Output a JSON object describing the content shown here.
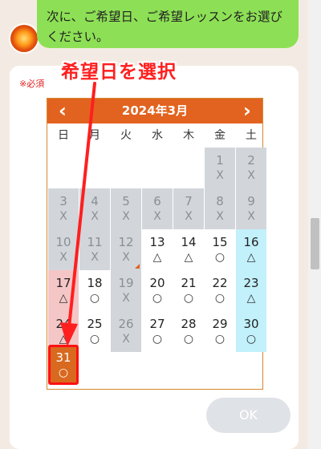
{
  "chat": {
    "message": "次に、ご希望日、ご希望レッスンをお選びください。"
  },
  "form": {
    "required_label": "※必須",
    "ok_button": "OK"
  },
  "annotation": {
    "text": "希望日を選択",
    "color": "#ff1f1f"
  },
  "calendar": {
    "title": "2024年3月",
    "prev_icon": "chevron-left-icon",
    "next_icon": "chevron-right-icon",
    "weekdays": [
      "日",
      "月",
      "火",
      "水",
      "木",
      "金",
      "土"
    ],
    "header_color": "#e2631f",
    "selected_day": "31",
    "weeks": [
      [
        null,
        null,
        null,
        null,
        null,
        {
          "day": "1",
          "mark": "X",
          "status": "past"
        },
        {
          "day": "2",
          "mark": "X",
          "status": "past"
        }
      ],
      [
        {
          "day": "3",
          "mark": "X",
          "status": "past"
        },
        {
          "day": "4",
          "mark": "X",
          "status": "past"
        },
        {
          "day": "5",
          "mark": "X",
          "status": "past"
        },
        {
          "day": "6",
          "mark": "X",
          "status": "past"
        },
        {
          "day": "7",
          "mark": "X",
          "status": "past"
        },
        {
          "day": "8",
          "mark": "X",
          "status": "past"
        },
        {
          "day": "9",
          "mark": "X",
          "status": "past"
        }
      ],
      [
        {
          "day": "10",
          "mark": "X",
          "status": "past"
        },
        {
          "day": "11",
          "mark": "X",
          "status": "past"
        },
        {
          "day": "12",
          "mark": "X",
          "status": "past"
        },
        {
          "day": "13",
          "mark": "△",
          "status": "open"
        },
        {
          "day": "14",
          "mark": "△",
          "status": "open"
        },
        {
          "day": "15",
          "mark": "○",
          "status": "open"
        },
        {
          "day": "16",
          "mark": "△",
          "status": "saturday"
        }
      ],
      [
        {
          "day": "17",
          "mark": "△",
          "status": "sunday"
        },
        {
          "day": "18",
          "mark": "○",
          "status": "open"
        },
        {
          "day": "19",
          "mark": "X",
          "status": "past"
        },
        {
          "day": "20",
          "mark": "○",
          "status": "open"
        },
        {
          "day": "21",
          "mark": "○",
          "status": "open"
        },
        {
          "day": "22",
          "mark": "○",
          "status": "open"
        },
        {
          "day": "23",
          "mark": "△",
          "status": "saturday"
        }
      ],
      [
        {
          "day": "24",
          "mark": "△",
          "status": "sunday"
        },
        {
          "day": "25",
          "mark": "○",
          "status": "open"
        },
        {
          "day": "26",
          "mark": "X",
          "status": "past"
        },
        {
          "day": "27",
          "mark": "○",
          "status": "open"
        },
        {
          "day": "28",
          "mark": "○",
          "status": "open"
        },
        {
          "day": "29",
          "mark": "○",
          "status": "open"
        },
        {
          "day": "30",
          "mark": "○",
          "status": "saturday"
        }
      ],
      [
        {
          "day": "31",
          "mark": "○",
          "status": "selected"
        },
        null,
        null,
        null,
        null,
        null,
        null
      ]
    ]
  }
}
